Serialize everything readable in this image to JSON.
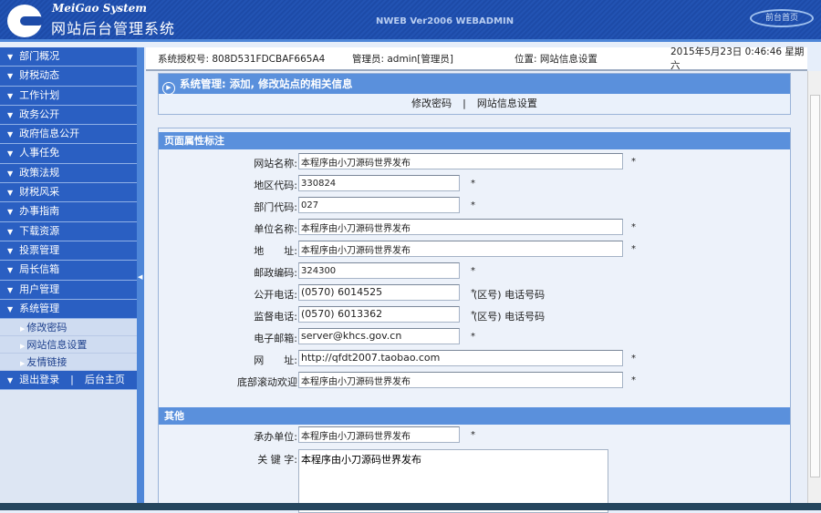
{
  "header": {
    "brand_en": "MeiGao System",
    "brand_cn": "网站后台管理系统",
    "version": "NWEB Ver2006 WEBADMIN",
    "front_link": "前台首页"
  },
  "sidebar": {
    "items": [
      "部门概况",
      "财税动态",
      "工作计划",
      "政务公开",
      "政府信息公开",
      "人事任免",
      "政策法规",
      "财税风采",
      "办事指南",
      "下载资源",
      "投票管理",
      "局长信箱",
      "用户管理",
      "系统管理"
    ],
    "subitems": [
      "修改密码",
      "网站信息设置",
      "友情链接"
    ],
    "logout": "退出登录",
    "separator": "|",
    "home": "后台主页"
  },
  "infobar": {
    "license": "系统授权号: 808D531FDCBAF665A4",
    "admin": "管理员: admin[管理员]",
    "location": "位置: 网站信息设置",
    "datetime": "2015年5月23日 0:46:46 星期六"
  },
  "panel": {
    "title": "系统管理: 添加, 修改站点的相关信息",
    "link1": "修改密码",
    "sep": "|",
    "link2": "网站信息设置"
  },
  "section1": {
    "title": "页面属性标注",
    "fields": [
      {
        "label": "网站名称:",
        "value": "本程序由小刀源码世界发布"
      },
      {
        "label": "地区代码:",
        "value": "330824"
      },
      {
        "label": "部门代码:",
        "value": "027"
      },
      {
        "label": "单位名称:",
        "value": "本程序由小刀源码世界发布"
      },
      {
        "label": "地　　址:",
        "value": "本程序由小刀源码世界发布"
      },
      {
        "label": "邮政编码:",
        "value": "324300"
      },
      {
        "label": "公开电话:",
        "value": "(0570) 6014525",
        "hint": "(区号) 电话号码"
      },
      {
        "label": "监督电话:",
        "value": "(0570) 6013362",
        "hint": "(区号) 电话号码"
      },
      {
        "label": "电子邮箱:",
        "value": "server@khcs.gov.cn"
      },
      {
        "label": "网　　址:",
        "value": "http://qfdt2007.taobao.com"
      },
      {
        "label": "底部滚动欢迎",
        "value": "本程序由小刀源码世界发布"
      }
    ],
    "required_mark": "*"
  },
  "section2": {
    "title": "其他",
    "fields": [
      {
        "label": "承办单位:",
        "value": "本程序由小刀源码世界发布"
      },
      {
        "label": "关 键 字:",
        "value": "本程序由小刀源码世界发布"
      }
    ]
  }
}
